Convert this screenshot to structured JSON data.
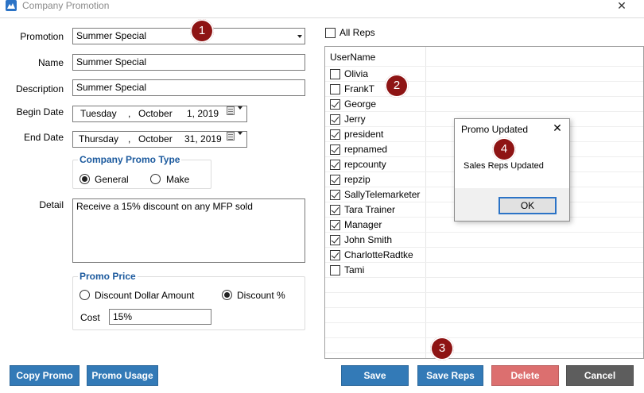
{
  "window": {
    "title": "Company Promotion",
    "close_glyph": "✕",
    "icon": "company-logo-icon"
  },
  "form": {
    "promotion_label": "Promotion",
    "promotion_value": "Summer Special",
    "name_label": "Name",
    "name_value": "Summer Special",
    "description_label": "Description",
    "description_value": "Summer Special",
    "begin_date_label": "Begin Date",
    "begin_date": {
      "weekday": "Tuesday",
      "sep": ",",
      "month": "October",
      "day": "1, 2019"
    },
    "end_date_label": "End Date",
    "end_date": {
      "weekday": "Thursday",
      "sep": ",",
      "month": "October",
      "day": "31, 2019"
    },
    "promo_type_title": "Company Promo Type",
    "promo_type_options": [
      "General",
      "Make"
    ],
    "promo_type_selected": "General",
    "detail_label": "Detail",
    "detail_value": "Receive a 15% discount on any MFP sold",
    "promo_price_title": "Promo Price",
    "price_options": [
      "Discount Dollar Amount",
      "Discount %"
    ],
    "price_selected": "Discount %",
    "cost_label": "Cost",
    "cost_value": "15%"
  },
  "reps": {
    "all_reps_label": "All Reps",
    "all_reps_checked": false,
    "column_header": "UserName",
    "items": [
      {
        "name": "Olivia",
        "checked": false
      },
      {
        "name": "FrankT",
        "checked": false
      },
      {
        "name": "George",
        "checked": true
      },
      {
        "name": "Jerry",
        "checked": true
      },
      {
        "name": "president",
        "checked": true
      },
      {
        "name": "repnamed",
        "checked": true
      },
      {
        "name": "repcounty",
        "checked": true
      },
      {
        "name": "repzip",
        "checked": true
      },
      {
        "name": "SallyTelemarketer",
        "checked": true
      },
      {
        "name": "Tara Trainer",
        "checked": true
      },
      {
        "name": "Manager",
        "checked": true
      },
      {
        "name": "John Smith",
        "checked": true
      },
      {
        "name": "CharlotteRadtke",
        "checked": true
      },
      {
        "name": "Tami",
        "checked": false
      }
    ]
  },
  "buttons": {
    "copy_promo": "Copy Promo",
    "promo_usage": "Promo Usage",
    "save": "Save",
    "save_reps": "Save Reps",
    "delete": "Delete",
    "cancel": "Cancel"
  },
  "dialog": {
    "title": "Promo Updated",
    "close_glyph": "✕",
    "message": "Sales Reps Updated",
    "ok_label": "OK"
  },
  "callouts": [
    "1",
    "2",
    "3",
    "4"
  ],
  "colors": {
    "accent_blue": "#337ab7",
    "delete_red": "#dc6f6f",
    "cancel_gray": "#5d5d5d",
    "callout_red": "#8e1414",
    "group_title_blue": "#1c5a9e"
  }
}
